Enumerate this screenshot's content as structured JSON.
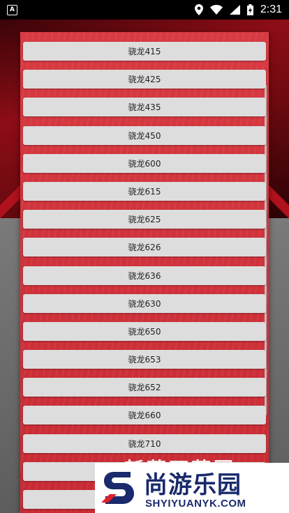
{
  "status_bar": {
    "time": "2:31"
  },
  "dialog": {
    "items": [
      {
        "label": "骁龙415"
      },
      {
        "label": "骁龙425"
      },
      {
        "label": "骁龙435"
      },
      {
        "label": "骁龙450"
      },
      {
        "label": "骁龙600"
      },
      {
        "label": "骁龙615"
      },
      {
        "label": "骁龙625"
      },
      {
        "label": "骁龙626"
      },
      {
        "label": "骁龙636"
      },
      {
        "label": "骁龙630"
      },
      {
        "label": "骁龙650"
      },
      {
        "label": "骁龙653"
      },
      {
        "label": "骁龙652"
      },
      {
        "label": "骁龙660"
      },
      {
        "label": "骁龙710"
      },
      {
        "label": ""
      },
      {
        "label": ""
      }
    ]
  },
  "background_text": "新薪石藩圆",
  "watermark": {
    "title": "尚游乐园",
    "url": "SHYIYUANYK.COM"
  },
  "colors": {
    "dialog_red": "#d6343c",
    "button_gray": "#dddddd",
    "watermark_blue": "#1a2a6c"
  }
}
